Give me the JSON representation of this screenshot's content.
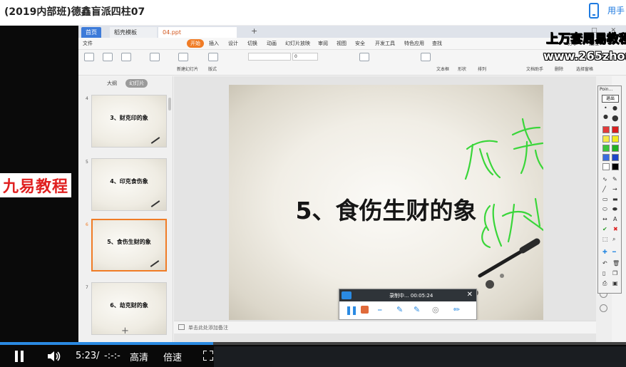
{
  "header": {
    "title": "(2019内部班)德鑫盲派四柱07",
    "app_link": "用手"
  },
  "logo": "九易教程",
  "watermark": {
    "line1": "上万套周易教程",
    "line2": "www.265zhouyiw.com"
  },
  "wps": {
    "tabs": [
      "首页",
      "稻壳模板",
      "04.ppt"
    ],
    "menus": [
      "文件",
      "开始",
      "插入",
      "设计",
      "切换",
      "动画",
      "幻灯片放映",
      "审阅",
      "视图",
      "安全",
      "开发工具",
      "特色应用",
      "查找",
      "分享",
      "批注"
    ],
    "ribbon": {
      "font_size": "0",
      "labels": [
        "新建幻灯片",
        "版式",
        "文本框",
        "形状",
        "排列",
        "文档助手",
        "删除",
        "选择窗格"
      ]
    },
    "panel_tabs": {
      "outline": "大纲",
      "slides": "幻灯片"
    },
    "thumbnails": [
      {
        "num": "4",
        "title": "3、财克印的象"
      },
      {
        "num": "5",
        "title": "4、印克食伤象"
      },
      {
        "num": "6",
        "title": "5、食伤生财的象"
      },
      {
        "num": "7",
        "title": "6、劫克财的象"
      }
    ],
    "slide_title": "5、食伤生财的象",
    "notes_placeholder": "单击此处添加备注",
    "user_button": "访客登录"
  },
  "recorder": {
    "status": "录制中... 00:05:24"
  },
  "palette": {
    "title": "Poin...",
    "exit": "退出",
    "colors": [
      "#e23a3a",
      "#d81e1e",
      "#f6e84a",
      "#f1ea20",
      "#3cc43c",
      "#22b022",
      "#3a6be0",
      "#1d44c8",
      "#ffffff",
      "#000000"
    ]
  },
  "player": {
    "time_current": "5:23",
    "time_separator": "/",
    "time_total": "-:-:-",
    "quality": "高清",
    "speed": "倍速",
    "progress": 0.34
  }
}
